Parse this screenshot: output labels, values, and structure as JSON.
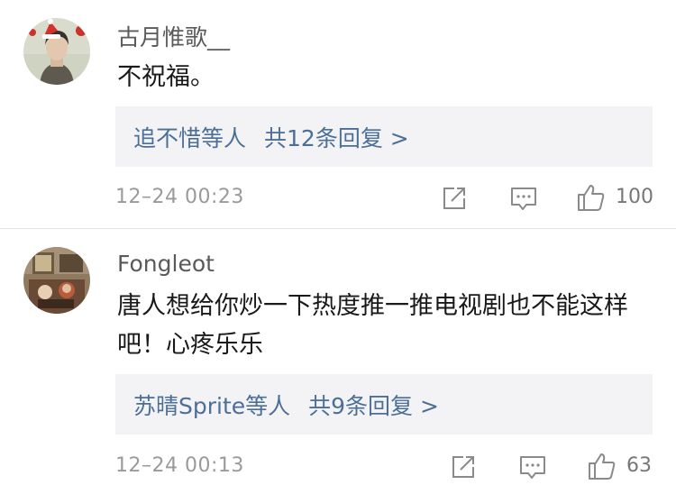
{
  "comments": [
    {
      "username": "古月惟歌__",
      "text": "不祝福。",
      "replies": {
        "names": "追不惜等人",
        "count_label": "共12条回复 >"
      },
      "timestamp": "12–24 00:23",
      "likes": "100"
    },
    {
      "username": "Fongleot",
      "text": "唐人想给你炒一下热度推一推电视剧也不能这样吧！心疼乐乐",
      "replies": {
        "names": "苏晴Sprite等人",
        "count_label": "共9条回复 >"
      },
      "timestamp": "12–24 00:13",
      "likes": "63"
    }
  ],
  "icons": {
    "share": "share-icon",
    "comment": "comment-icon",
    "like": "thumbs-up-icon"
  },
  "colors": {
    "link_blue": "#4b6f96",
    "reply_bg": "#f3f3f5",
    "meta_gray": "#9a9a9a"
  }
}
